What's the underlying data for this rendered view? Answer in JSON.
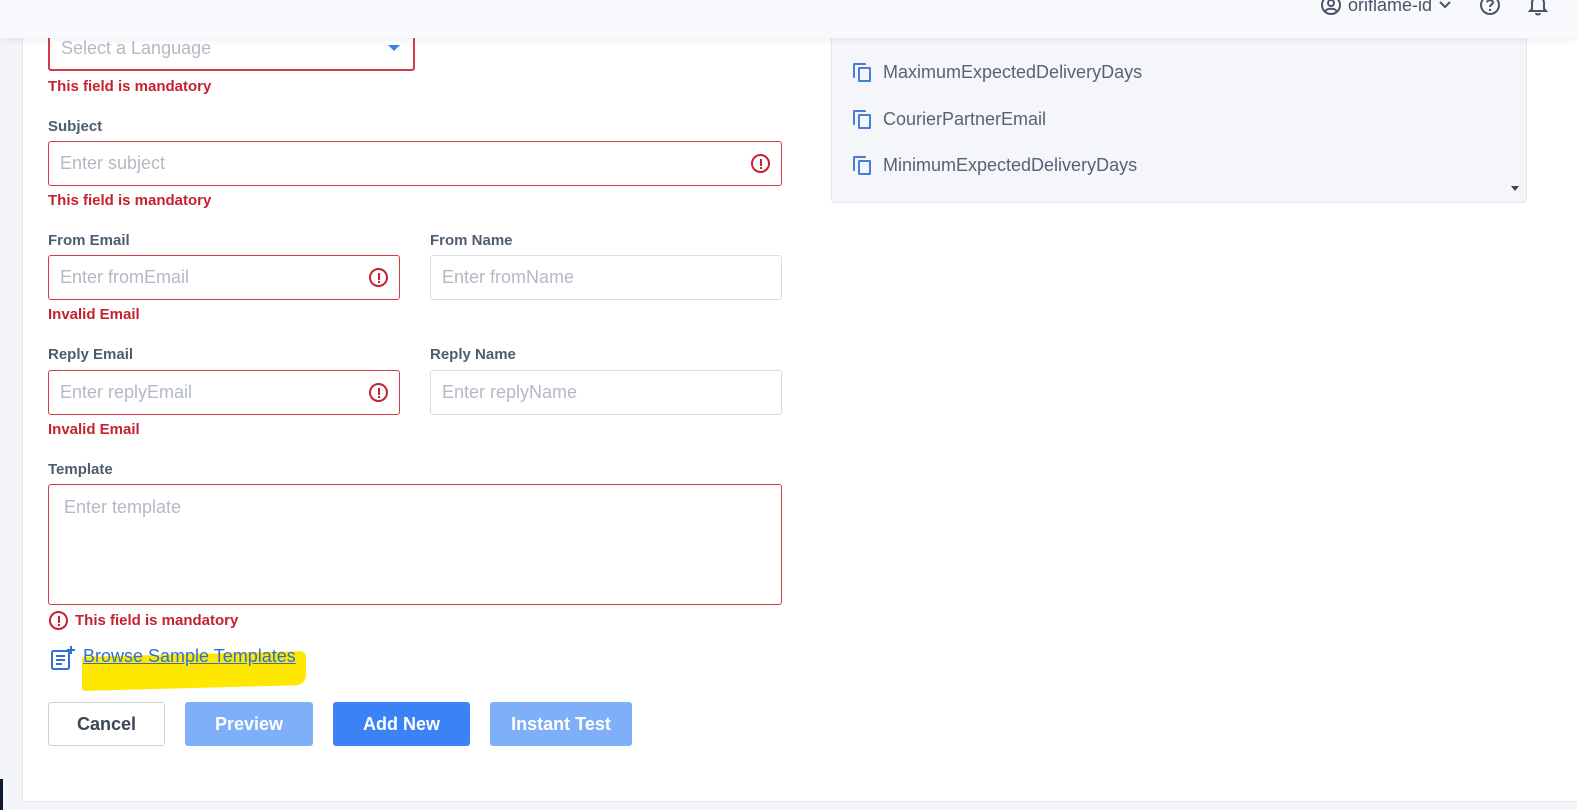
{
  "header": {
    "account_name": "oriflame-id",
    "icons": [
      "user-circle-icon",
      "chevron-down-icon",
      "help-circle-icon",
      "bell-icon"
    ]
  },
  "form": {
    "language": {
      "placeholder": "Select a Language",
      "error": "This field is mandatory"
    },
    "subject": {
      "label": "Subject",
      "placeholder": "Enter subject",
      "error": "This field is mandatory"
    },
    "from_email": {
      "label": "From Email",
      "placeholder": "Enter fromEmail",
      "error": "Invalid Email"
    },
    "from_name": {
      "label": "From Name",
      "placeholder": "Enter fromName"
    },
    "reply_email": {
      "label": "Reply Email",
      "placeholder": "Enter replyEmail",
      "error": "Invalid Email"
    },
    "reply_name": {
      "label": "Reply Name",
      "placeholder": "Enter replyName"
    },
    "template": {
      "label": "Template",
      "placeholder": "Enter template",
      "error": "This field is mandatory"
    },
    "browse_link": "Browse Sample Templates"
  },
  "variables": {
    "items": [
      {
        "label": "MaximumExpectedDeliveryDays"
      },
      {
        "label": "CourierPartnerEmail"
      },
      {
        "label": "MinimumExpectedDeliveryDays"
      }
    ]
  },
  "actions": {
    "cancel": "Cancel",
    "preview": "Preview",
    "add_new": "Add New",
    "instant_test": "Instant Test"
  },
  "colors": {
    "primary": "#3b82f6",
    "primary_disabled": "#7faff8",
    "error": "#c5222f",
    "highlight": "#ffe800"
  }
}
